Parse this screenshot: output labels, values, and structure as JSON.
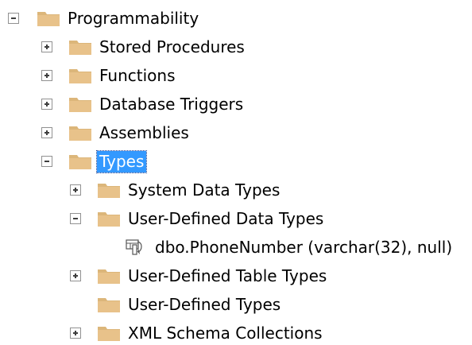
{
  "tree": {
    "programmability": {
      "label": "Programmability",
      "state": "expanded"
    },
    "stored_procedures": {
      "label": "Stored Procedures",
      "state": "collapsed"
    },
    "functions": {
      "label": "Functions",
      "state": "collapsed"
    },
    "database_triggers": {
      "label": "Database Triggers",
      "state": "collapsed"
    },
    "assemblies": {
      "label": "Assemblies",
      "state": "collapsed"
    },
    "types": {
      "label": "Types",
      "state": "expanded",
      "selected": true
    },
    "system_data_types": {
      "label": "System Data Types",
      "state": "collapsed"
    },
    "user_defined_data_types": {
      "label": "User-Defined Data Types",
      "state": "expanded"
    },
    "phone_number": {
      "label": "dbo.PhoneNumber (varchar(32), null)",
      "icon": "user-defined-type-icon"
    },
    "user_defined_table_types": {
      "label": "User-Defined Table Types",
      "state": "collapsed"
    },
    "user_defined_types": {
      "label": "User-Defined Types",
      "state": "no-children"
    },
    "xml_schema_collections": {
      "label": "XML Schema Collections",
      "state": "collapsed"
    }
  },
  "colors": {
    "folder": "#dcb67a",
    "selection": "#3399ff",
    "expander_border": "#919191"
  }
}
